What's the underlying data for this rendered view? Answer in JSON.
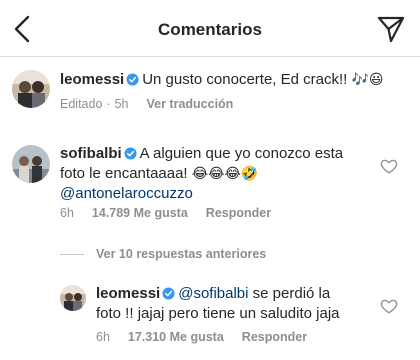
{
  "header": {
    "title": "Comentarios"
  },
  "comments": [
    {
      "username": "leomessi",
      "text": "Un gusto conocerte, Ed crack!!",
      "emojis": "🎶😃",
      "meta_edited": "Editado",
      "meta_sep": "·",
      "meta_time": "5h",
      "meta_translate": "Ver traducción"
    },
    {
      "username": "sofibalbi",
      "text_line1": "A alguien que yo conozco esta",
      "text_line2": "foto le encantaaaa!",
      "emojis": "😂😂😂🤣",
      "mention": "@antonelaroccuzzo",
      "meta_time": "6h",
      "meta_likes": "14.789 Me gusta",
      "meta_reply": "Responder"
    }
  ],
  "replies_toggle": "Ver 10 respuestas anteriores",
  "reply": {
    "username": "leomessi",
    "mention": "@sofibalbi",
    "text_line1_rest": "se perdió la",
    "text_line2": "foto !! jajaj pero tiene un saludito jaja",
    "meta_time": "6h",
    "meta_likes": "17.310 Me gusta",
    "meta_reply": "Responder"
  },
  "colors": {
    "verified_blue": "#3897f0",
    "mention_blue": "#00376b",
    "secondary_text": "#8e8e8e"
  },
  "icons": [
    "back-arrow-icon",
    "send-icon",
    "verified-icon",
    "heart-icon"
  ]
}
